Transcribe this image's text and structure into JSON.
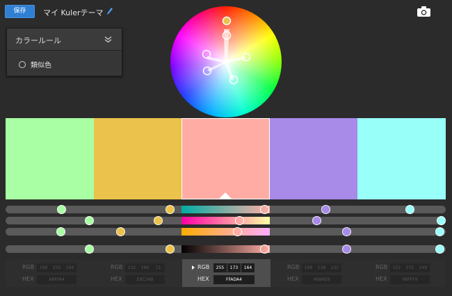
{
  "toolbar": {
    "save_label": "保存",
    "theme_name": "マイ Kulerテーマ"
  },
  "rule_panel": {
    "title": "カラールール",
    "option": "類似色"
  },
  "swatches": [
    {
      "hex": "#A8FFA4"
    },
    {
      "hex": "#EBC24B"
    },
    {
      "hex": "#FFADA4"
    },
    {
      "hex": "#A88AE8"
    },
    {
      "hex": "#98FFF9"
    }
  ],
  "selected_index": 2,
  "values": [
    {
      "rgb": [
        "168",
        "255",
        "164"
      ],
      "hex": "A8FFA4"
    },
    {
      "rgb": [
        "232",
        "194",
        "72"
      ],
      "hex": "EBC24B"
    },
    {
      "rgb": [
        "255",
        "173",
        "164"
      ],
      "hex": "FFADA4"
    },
    {
      "rgb": [
        "168",
        "138",
        "232"
      ],
      "hex": "A88AE8"
    },
    {
      "rgb": [
        "152",
        "255",
        "249"
      ],
      "hex": "98FFF9"
    }
  ],
  "labels": {
    "rgb": "RGB",
    "hex": "HEX"
  }
}
